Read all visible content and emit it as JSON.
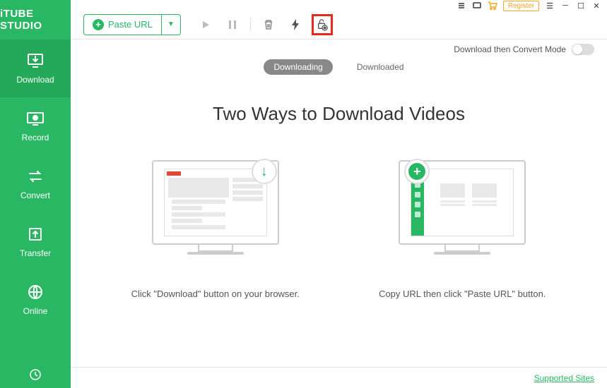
{
  "app": {
    "name": "iTUBE STUDIO"
  },
  "sidebar": {
    "items": [
      {
        "label": "Download"
      },
      {
        "label": "Record"
      },
      {
        "label": "Convert"
      },
      {
        "label": "Transfer"
      },
      {
        "label": "Online"
      }
    ]
  },
  "titlebar": {
    "register": "Register"
  },
  "toolbar": {
    "paste_url": "Paste URL",
    "mode_label": "Download then Convert Mode"
  },
  "tabs": {
    "downloading": "Downloading",
    "downloaded": "Downloaded"
  },
  "content": {
    "headline": "Two Ways to Download Videos",
    "way1": "Click \"Download\" button on your browser.",
    "way2": "Copy URL then click \"Paste URL\" button."
  },
  "footer": {
    "supported_sites": "Supported Sites"
  }
}
